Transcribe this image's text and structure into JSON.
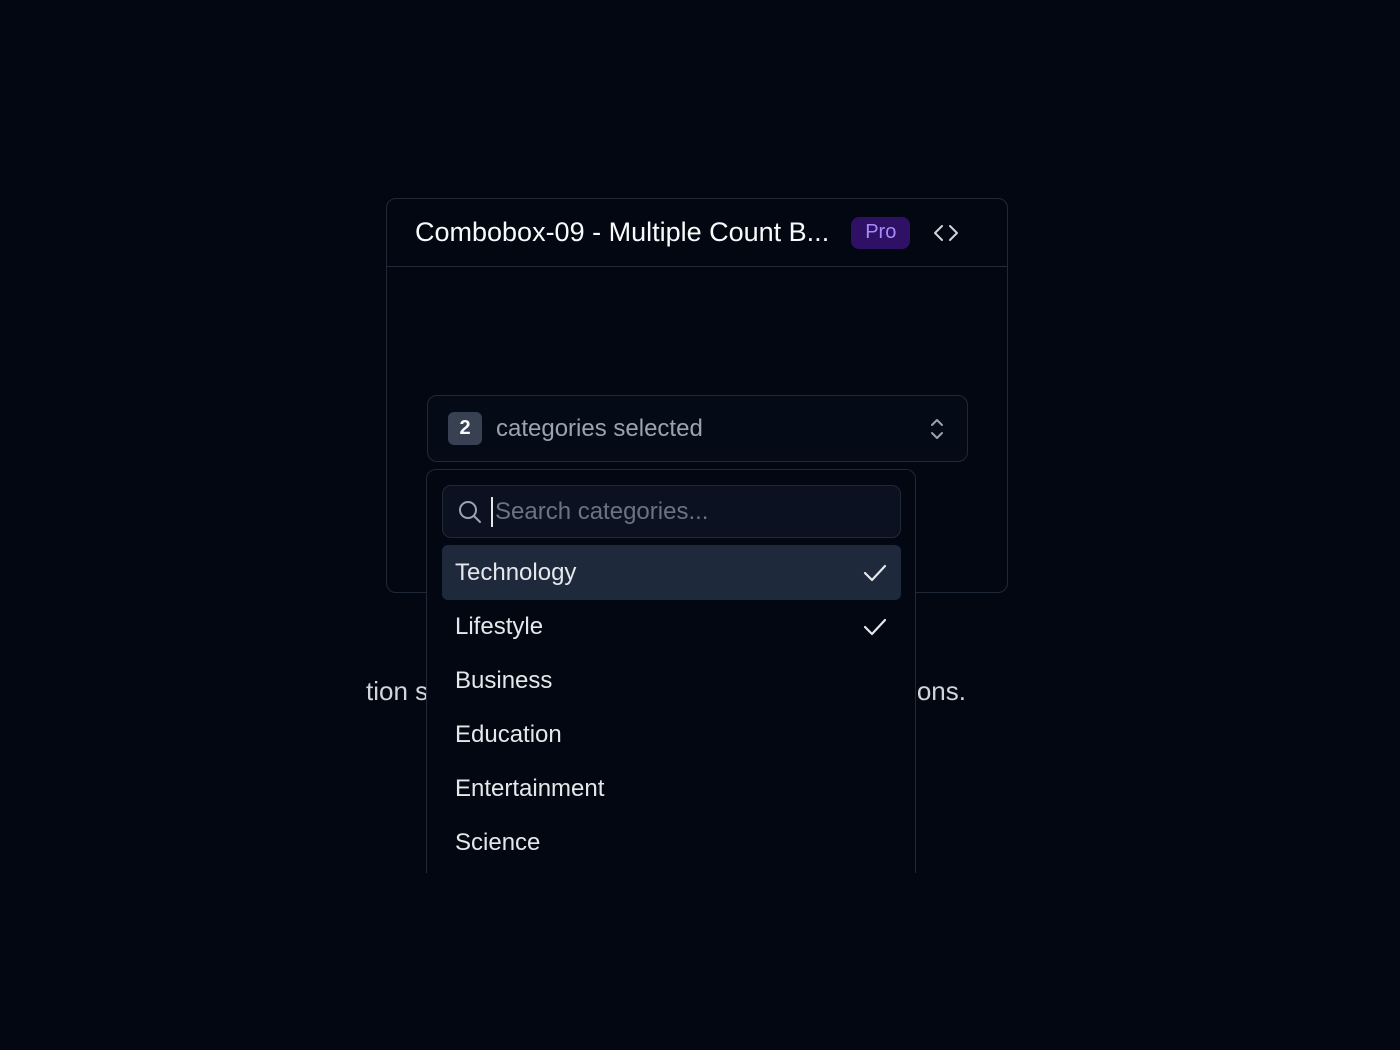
{
  "card": {
    "title": "Combobox-09 - Multiple Count B...",
    "badge": "Pro",
    "code_icon": "code-brackets-icon"
  },
  "background_text": {
    "left": "tion s",
    "right": "ons."
  },
  "combobox": {
    "count": "2",
    "label": "categories selected",
    "toggle_icon": "chevrons-up-down-icon"
  },
  "search": {
    "placeholder": "Search categories...",
    "icon": "search-icon"
  },
  "options": [
    {
      "label": "Technology",
      "selected": true,
      "highlighted": true
    },
    {
      "label": "Lifestyle",
      "selected": true,
      "highlighted": false
    },
    {
      "label": "Business",
      "selected": false,
      "highlighted": false
    },
    {
      "label": "Education",
      "selected": false,
      "highlighted": false
    },
    {
      "label": "Entertainment",
      "selected": false,
      "highlighted": false
    },
    {
      "label": "Science",
      "selected": false,
      "highlighted": false
    }
  ],
  "colors": {
    "background": "#030712",
    "highlight": "#1e293b",
    "badge_bg": "#2e1065",
    "badge_text": "#a78bfa"
  }
}
